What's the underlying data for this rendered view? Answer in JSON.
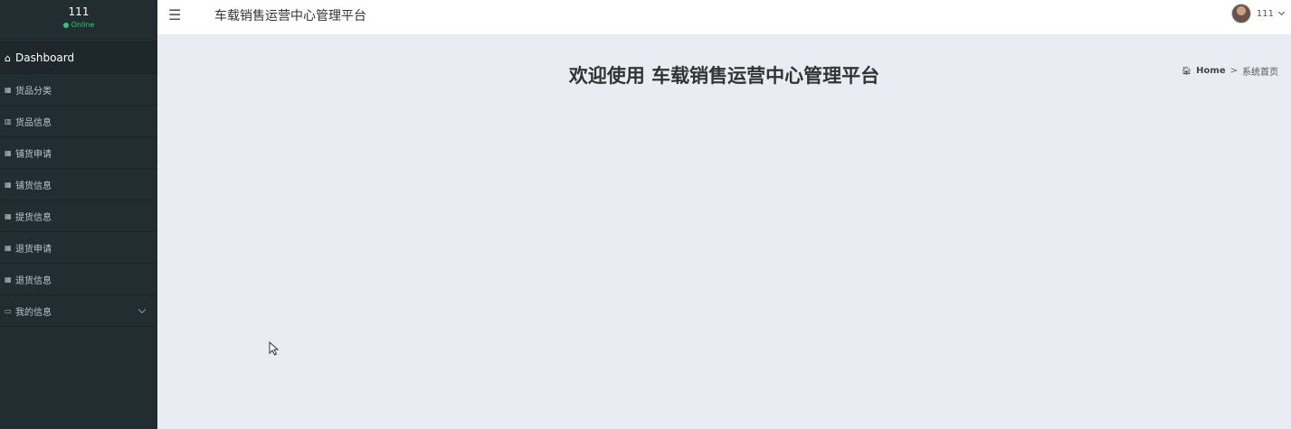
{
  "sidebar": {
    "user_name": "111",
    "status": "Online",
    "items": [
      {
        "label": "Dashboard",
        "icon": "⌂"
      },
      {
        "label": "货品分类",
        "icon": "▦"
      },
      {
        "label": "货品信息",
        "icon": "▥"
      },
      {
        "label": "铺货申请",
        "icon": "▦"
      },
      {
        "label": "铺货信息",
        "icon": "▦"
      },
      {
        "label": "提货信息",
        "icon": "▦"
      },
      {
        "label": "退货申请",
        "icon": "▦"
      },
      {
        "label": "退货信息",
        "icon": "▦"
      },
      {
        "label": "我的信息",
        "icon": "▭"
      }
    ]
  },
  "header": {
    "menu_toggle_icon": "☰",
    "title": "车载销售运营中心管理平台",
    "user": "111"
  },
  "main": {
    "welcome": "欢迎使用 车载销售运营中心管理平台",
    "breadcrumb": {
      "home": "Home",
      "separator": ">",
      "current": "系统首页"
    }
  },
  "colors": {
    "sidebar_bg": "#222d32",
    "content_bg": "#e9ecf3",
    "online": "#2ecc71"
  }
}
